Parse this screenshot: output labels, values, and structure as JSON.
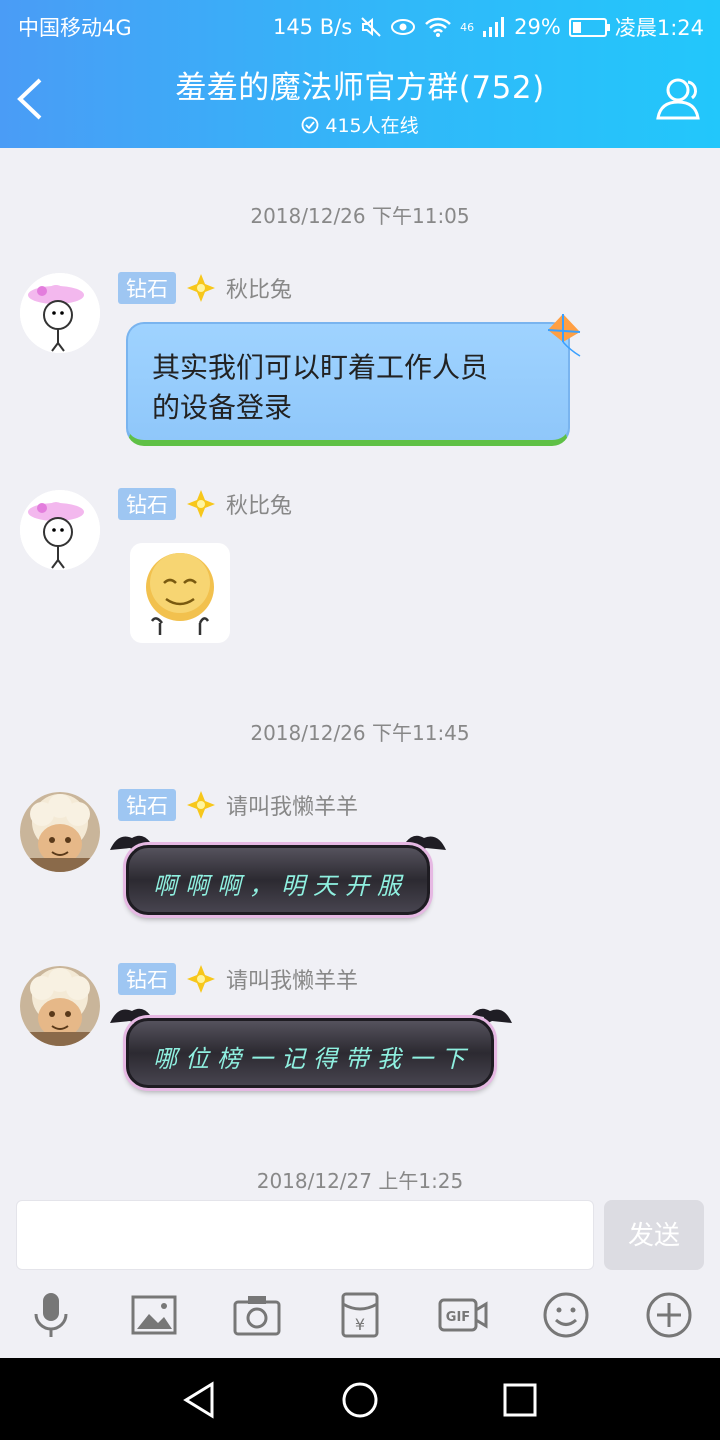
{
  "status_bar": {
    "carrier": "中国移动4G",
    "speed": "145 B/s",
    "network": "46",
    "battery": "29%",
    "time": "凌晨1:24"
  },
  "header": {
    "title": "羞羞的魔法师官方群(752)",
    "online": "415人在线"
  },
  "messages": [
    {
      "timestamp": "2018/12/26 下午11:05"
    },
    {
      "badge": "钻石",
      "sender": "秋比兔",
      "text_line1": "其实我们可以盯着工作人员",
      "text_line2": "的设备登录"
    },
    {
      "badge": "钻石",
      "sender": "秋比兔",
      "sticker": "smiley-sticker"
    },
    {
      "timestamp": "2018/12/26 下午11:45"
    },
    {
      "badge": "钻石",
      "sender": "请叫我懒羊羊",
      "text": "啊啊啊，明天开服"
    },
    {
      "badge": "钻石",
      "sender": "请叫我懒羊羊",
      "text": "哪位榜一记得带我一下"
    },
    {
      "timestamp": "2018/12/27 上午1:25"
    }
  ],
  "input": {
    "placeholder": "",
    "send_label": "发送"
  },
  "toolbar": [
    "mic-icon",
    "image-icon",
    "camera-icon",
    "red-packet-icon",
    "gif-icon",
    "emoji-icon",
    "plus-icon"
  ],
  "colors": {
    "header_start": "#4a9cf6",
    "header_end": "#22c7fb",
    "badge": "#9ec6f2",
    "bubble_blue": "#9fd3ff"
  }
}
